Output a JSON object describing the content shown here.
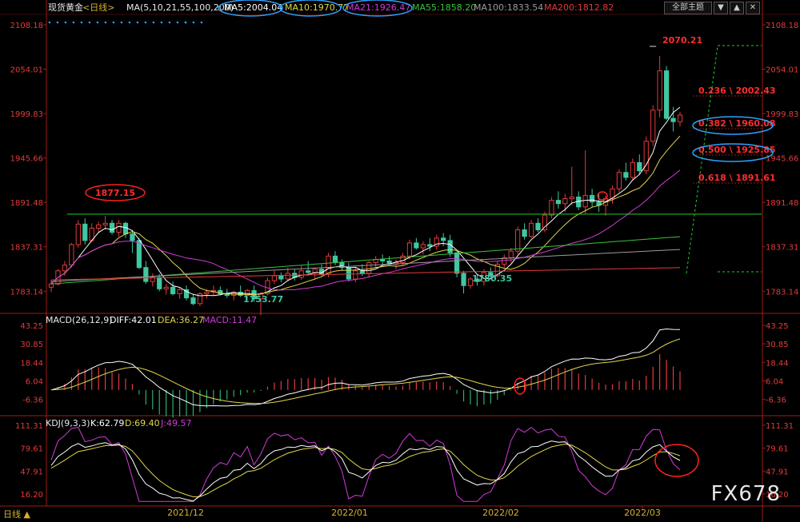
{
  "header": {
    "symbol": "现货黄金",
    "period": "<日线>",
    "ma_params": "MA(5,10,21,55,100,200)",
    "ma_values": [
      {
        "label": "MA5:2004.04",
        "color": "#ffffff"
      },
      {
        "label": "MA10:1970.77",
        "color": "#e3d64b"
      },
      {
        "label": "MA21:1926.47",
        "color": "#d13bd9"
      },
      {
        "label": "MA55:1858.20",
        "color": "#38c33a"
      },
      {
        "label": "MA100:1833.54",
        "color": "#9a9a9a"
      },
      {
        "label": "MA200:1812.82",
        "color": "#e13b3b"
      }
    ],
    "buttons": [
      "全部主题",
      "▼",
      "▲",
      "✕"
    ]
  },
  "chart_data": [
    {
      "type": "candlestick",
      "title": "现货黄金 <日线>",
      "ylim": [
        1760,
        2115
      ],
      "y_ticks": [
        2108.18,
        2054.01,
        1999.83,
        1945.66,
        1891.48,
        1837.31,
        1783.14
      ],
      "x_ticks": [
        "2021/12",
        "2022/01",
        "2022/02",
        "2022/03"
      ],
      "ohlc": [
        [
          1788,
          1797,
          1782,
          1792
        ],
        [
          1792,
          1810,
          1790,
          1808
        ],
        [
          1808,
          1820,
          1802,
          1815
        ],
        [
          1815,
          1842,
          1812,
          1840
        ],
        [
          1840,
          1870,
          1836,
          1865
        ],
        [
          1865,
          1872,
          1840,
          1845
        ],
        [
          1845,
          1866,
          1843,
          1860
        ],
        [
          1860,
          1868,
          1855,
          1864
        ],
        [
          1864,
          1875,
          1858,
          1866
        ],
        [
          1866,
          1870,
          1852,
          1855
        ],
        [
          1855,
          1870,
          1850,
          1866
        ],
        [
          1866,
          1868,
          1848,
          1853
        ],
        [
          1853,
          1858,
          1830,
          1845
        ],
        [
          1845,
          1848,
          1810,
          1812
        ],
        [
          1812,
          1820,
          1792,
          1795
        ],
        [
          1795,
          1805,
          1789,
          1800
        ],
        [
          1800,
          1804,
          1783,
          1786
        ],
        [
          1786,
          1792,
          1779,
          1788
        ],
        [
          1788,
          1795,
          1778,
          1780
        ],
        [
          1780,
          1787,
          1774,
          1785
        ],
        [
          1785,
          1790,
          1772,
          1775
        ],
        [
          1775,
          1780,
          1766,
          1768
        ],
        [
          1768,
          1782,
          1765,
          1780
        ],
        [
          1780,
          1786,
          1774,
          1782
        ],
        [
          1782,
          1790,
          1778,
          1784
        ],
        [
          1784,
          1789,
          1778,
          1780
        ],
        [
          1780,
          1786,
          1775,
          1778
        ],
        [
          1778,
          1784,
          1772,
          1782
        ],
        [
          1782,
          1790,
          1776,
          1778
        ],
        [
          1778,
          1786,
          1772,
          1784
        ],
        [
          1784,
          1790,
          1770,
          1774
        ],
        [
          1774,
          1782,
          1753.77,
          1780
        ],
        [
          1780,
          1800,
          1778,
          1796
        ],
        [
          1796,
          1808,
          1792,
          1802
        ],
        [
          1802,
          1806,
          1794,
          1798
        ],
        [
          1798,
          1812,
          1795,
          1805
        ],
        [
          1805,
          1810,
          1796,
          1800
        ],
        [
          1800,
          1815,
          1797,
          1808
        ],
        [
          1808,
          1820,
          1802,
          1806
        ],
        [
          1806,
          1812,
          1798,
          1810
        ],
        [
          1810,
          1816,
          1802,
          1804
        ],
        [
          1804,
          1830,
          1800,
          1826
        ],
        [
          1826,
          1832,
          1815,
          1818
        ],
        [
          1818,
          1822,
          1808,
          1812
        ],
        [
          1812,
          1818,
          1795,
          1798
        ],
        [
          1798,
          1812,
          1794,
          1808
        ],
        [
          1808,
          1816,
          1802,
          1805
        ],
        [
          1805,
          1820,
          1800,
          1818
        ],
        [
          1818,
          1826,
          1812,
          1822
        ],
        [
          1822,
          1828,
          1816,
          1820
        ],
        [
          1820,
          1826,
          1814,
          1816
        ],
        [
          1816,
          1822,
          1810,
          1818
        ],
        [
          1818,
          1830,
          1815,
          1826
        ],
        [
          1826,
          1846,
          1822,
          1842
        ],
        [
          1842,
          1848,
          1834,
          1836
        ],
        [
          1836,
          1844,
          1828,
          1840
        ],
        [
          1840,
          1848,
          1832,
          1838
        ],
        [
          1838,
          1852,
          1834,
          1848
        ],
        [
          1848,
          1854,
          1838,
          1845
        ],
        [
          1845,
          1852,
          1825,
          1830
        ],
        [
          1830,
          1832,
          1800,
          1805
        ],
        [
          1805,
          1808,
          1780.35,
          1790
        ],
        [
          1790,
          1800,
          1786,
          1798
        ],
        [
          1798,
          1804,
          1790,
          1795
        ],
        [
          1795,
          1810,
          1790,
          1806
        ],
        [
          1806,
          1812,
          1798,
          1802
        ],
        [
          1802,
          1820,
          1800,
          1816
        ],
        [
          1816,
          1828,
          1812,
          1824
        ],
        [
          1824,
          1836,
          1818,
          1832
        ],
        [
          1832,
          1862,
          1828,
          1858
        ],
        [
          1858,
          1866,
          1846,
          1850
        ],
        [
          1850,
          1870,
          1848,
          1866
        ],
        [
          1866,
          1872,
          1855,
          1858
        ],
        [
          1858,
          1880,
          1855,
          1876
        ],
        [
          1876,
          1898,
          1872,
          1894
        ],
        [
          1894,
          1905,
          1884,
          1890
        ],
        [
          1890,
          1902,
          1880,
          1896
        ],
        [
          1896,
          1935,
          1888,
          1898
        ],
        [
          1898,
          1905,
          1882,
          1886
        ],
        [
          1886,
          1955,
          1878,
          1900
        ],
        [
          1900,
          1908,
          1886,
          1892
        ],
        [
          1892,
          1902,
          1880,
          1888
        ],
        [
          1888,
          1900,
          1875,
          1896
        ],
        [
          1896,
          1912,
          1890,
          1908
        ],
        [
          1908,
          1932,
          1904,
          1928
        ],
        [
          1928,
          1940,
          1918,
          1922
        ],
        [
          1922,
          1945,
          1918,
          1940
        ],
        [
          1940,
          1950,
          1925,
          1930
        ],
        [
          1930,
          1972,
          1926,
          1966
        ],
        [
          1966,
          2010,
          1960,
          2004
        ],
        [
          2004,
          2070.21,
          1995,
          2052
        ],
        [
          2052,
          2058,
          1992,
          1994
        ],
        [
          1994,
          2008,
          1978,
          1990
        ],
        [
          1990,
          2002,
          1984,
          1998
        ]
      ],
      "ma_series": [
        "MA5",
        "MA10",
        "MA21",
        "MA55",
        "MA100",
        "MA200"
      ],
      "annotations": {
        "high_label": "2070.21",
        "low_labels": [
          "1753.77",
          "1780.35"
        ],
        "circled_level": "1877.15",
        "horizontal_level": 1877.15,
        "fib_levels": [
          {
            "label": "0.236 \\ 2002.43",
            "value": 2002.43
          },
          {
            "label": "0.382 \\ 1960.08",
            "value": 1960.08
          },
          {
            "label": "0.500 \\ 1925.85",
            "value": 1925.85
          },
          {
            "label": "0.618 \\ 1891.61",
            "value": 1891.61
          }
        ]
      }
    },
    {
      "type": "line",
      "title": "MACD(26,12,9)",
      "legend": [
        {
          "label": "DIFF:42.01",
          "color": "#ffffff"
        },
        {
          "label": "DEA:36.27",
          "color": "#e3d64b"
        },
        {
          "label": "MACD:11.47",
          "color": "#d13bd9"
        }
      ],
      "ylim": [
        -14,
        48
      ],
      "y_ticks": [
        43.25,
        30.85,
        18.44,
        6.04,
        -6.36
      ]
    },
    {
      "type": "line",
      "title": "KDJ(9,3,3)",
      "legend": [
        {
          "label": "K:62.79",
          "color": "#ffffff"
        },
        {
          "label": "D:69.40",
          "color": "#e3d64b"
        },
        {
          "label": "J:49.57",
          "color": "#d13bd9"
        }
      ],
      "ylim": [
        4,
        120
      ],
      "y_ticks": [
        111.31,
        79.61,
        47.91,
        16.2
      ]
    }
  ],
  "footer": {
    "period_button": "日线 ▲",
    "watermark": "FX678"
  },
  "colors": {
    "up": "#e23b3b",
    "down": "#3fc7a2",
    "axis": "#9b1d1d",
    "tick_text": "#e23b3b",
    "annotation": "#ff2d2d",
    "ellipse_red": "#ff2020",
    "ellipse_blue": "#2ba3ff",
    "guide": "#1fd12a"
  }
}
